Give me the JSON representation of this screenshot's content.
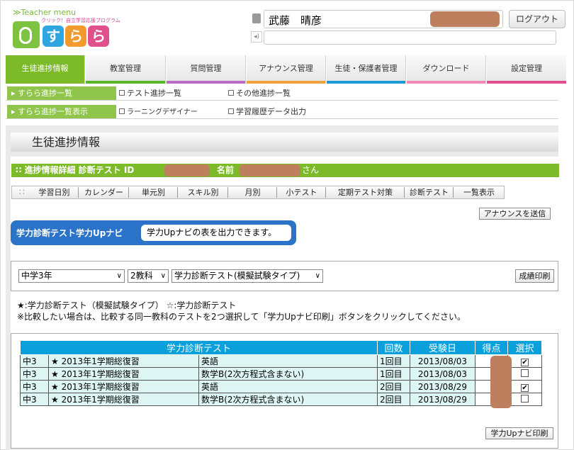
{
  "header": {
    "teacher_menu": "≫Teacher menu",
    "logo_sub": "クリック！自立学習応援プログラム",
    "logo_chars": [
      "す",
      "ら",
      "ら"
    ],
    "user_name": "武藤　晴彦",
    "logout": "ログアウト",
    "speaker_icon": "speaker-icon",
    "user_icon": "user-icon"
  },
  "nav": [
    {
      "label": "生徒進捗情報",
      "color": "#7dba29"
    },
    {
      "label": "教室管理",
      "color": "#5ab72b"
    },
    {
      "label": "質問管理",
      "color": "#b76bc4"
    },
    {
      "label": "アナウンス管理",
      "color": "#f0a33a"
    },
    {
      "label": "生徒・保護者管理",
      "color": "#1e9bd7"
    },
    {
      "label": "ダウンロード",
      "color": "#f08ab4"
    },
    {
      "label": "設定管理",
      "color": "#e0508c"
    }
  ],
  "subnav": {
    "row1": {
      "green": "すらら進捗一覧",
      "links": [
        "テスト進捗一覧",
        "その他進捗一覧"
      ]
    },
    "row2": {
      "green": "すらら進捗一覧表示",
      "links": [
        "ラーニングデザイナー",
        "学習履歴データ出力"
      ]
    }
  },
  "page_title": "生徒進捗情報",
  "detail": {
    "label": "進捗情報詳細 診断テスト ID",
    "name_label": "名前",
    "suffix": "さん"
  },
  "tabs": [
    "学習日別",
    "カレンダー",
    "単元別",
    "スキル別",
    "月別",
    "小テスト",
    "定期テスト対策",
    "診断テスト",
    "一覧表示"
  ],
  "announce_btn": "アナウンスを送信",
  "pill": {
    "left": "学力診断テスト学力Upナビ",
    "right": "学力Upナビの表を出力できます。"
  },
  "selects": {
    "grade": "中学3年",
    "subjects": "2教科",
    "test_type": "学力診断テスト(模擬試験タイプ)"
  },
  "print_btn": "成績印刷",
  "notes": {
    "line1": "★:学力診断テスト（模擬試験タイプ）  ☆:学力診断テスト",
    "line2": "※比較したい場合は、比較する同一教科のテストを2つ選択して「学力Upナビ印刷」ボタンをクリックしてください。"
  },
  "table": {
    "headers": [
      "学力診断テスト",
      "回数",
      "受験日",
      "得点",
      "選択"
    ],
    "rows": [
      {
        "grade": "中3",
        "test": "★ 2013年1学期総復習",
        "subject": "英語",
        "count": "1回目",
        "date": "2013/08/03",
        "checked": "✔"
      },
      {
        "grade": "中3",
        "test": "★ 2013年1学期総復習",
        "subject": "数学B(2次方程式含まない)",
        "count": "1回目",
        "date": "2013/08/03",
        "checked": ""
      },
      {
        "grade": "中3",
        "test": "★ 2013年1学期総復習",
        "subject": "英語",
        "count": "2回目",
        "date": "2013/08/29",
        "checked": "✔"
      },
      {
        "grade": "中3",
        "test": "★ 2013年1学期総復習",
        "subject": "数学B(2次方程式含まない)",
        "count": "2回目",
        "date": "2013/08/29",
        "checked": ""
      }
    ]
  },
  "navi_print_btn": "学力Upナビ印刷",
  "chevron": "∨"
}
